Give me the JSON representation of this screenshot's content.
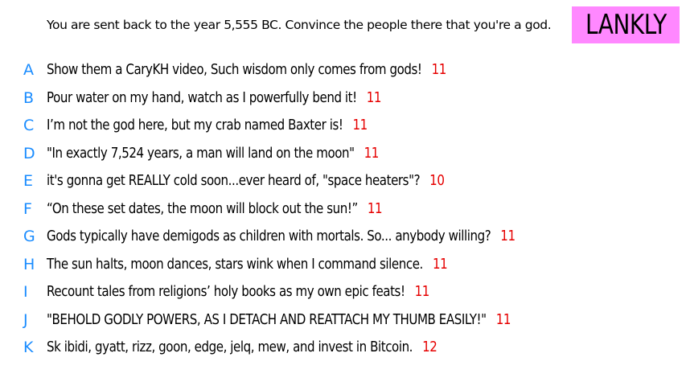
{
  "prompt": "You are sent back to the year 5,555 BC. Convince the people there that you're a god.",
  "nameplate": {
    "text": "LANKLY",
    "background": "#ff88ff"
  },
  "colors": {
    "letter": "#1a8cff",
    "count": "#e60000"
  },
  "options": [
    {
      "letter": "A",
      "text": "Show them a CaryKH video, Such wisdom only comes from gods!",
      "count": "11"
    },
    {
      "letter": "B",
      "text": "Pour water on my hand, watch as I powerfully bend it!",
      "count": "11"
    },
    {
      "letter": "C",
      "text": "I’m not the god here, but my crab named Baxter is!",
      "count": "11"
    },
    {
      "letter": "D",
      "text": "\"In exactly 7,524 years, a man will land on the moon\"",
      "count": "11"
    },
    {
      "letter": "E",
      "text": "it's gonna get REALLY cold soon...ever heard of, \"space heaters\"?",
      "count": "10"
    },
    {
      "letter": "F",
      "text": "“On these set dates, the moon will block out the sun!”",
      "count": "11"
    },
    {
      "letter": "G",
      "text": "Gods typically have demigods as children with mortals. So... anybody willing?",
      "count": "11"
    },
    {
      "letter": "H",
      "text": "The sun halts, moon dances, stars wink when I command silence.",
      "count": "11"
    },
    {
      "letter": "I",
      "text": "Recount tales from religions’ holy books as my own epic feats!",
      "count": "11"
    },
    {
      "letter": "J",
      "text": "\"BEHOLD GODLY POWERS, AS I DETACH AND REATTACH MY THUMB EASILY!\"",
      "count": "11"
    },
    {
      "letter": "K",
      "text": "Sk ibidi, gyatt, rizz, goon, edge, jelq, mew, and invest in Bitcoin.",
      "count": "12"
    }
  ]
}
